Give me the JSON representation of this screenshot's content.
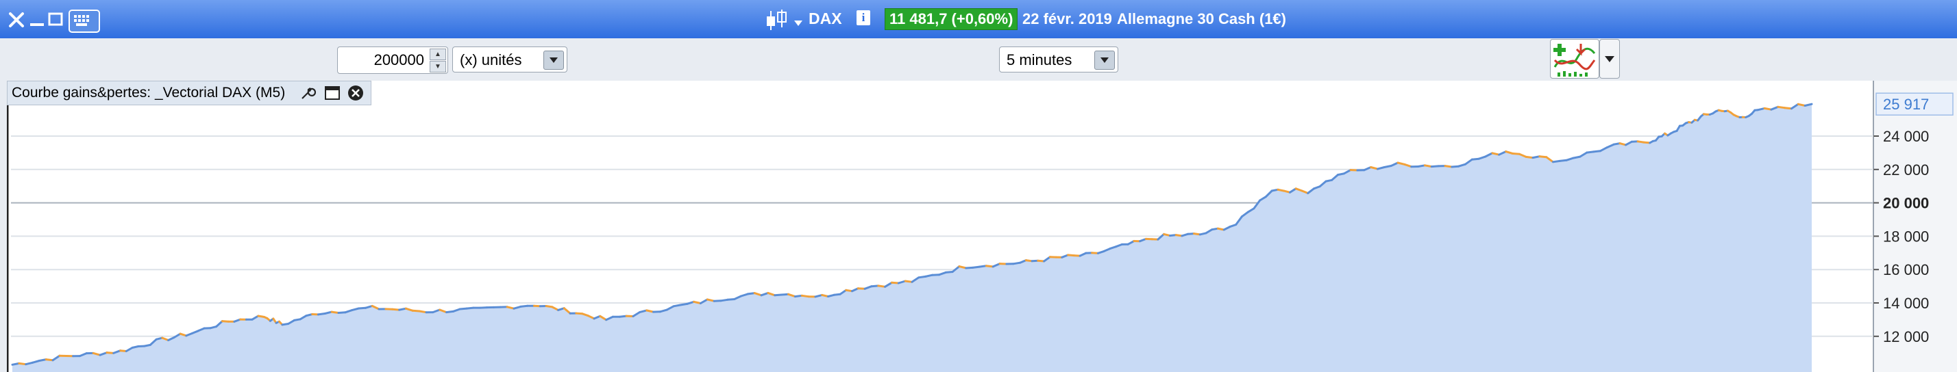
{
  "window": {
    "close_icon": "close-icon",
    "minimize_icon": "minimize-icon",
    "maximize_icon": "maximize-icon",
    "keyboard_icon": "keyboard-icon"
  },
  "header": {
    "symbol": "DAX",
    "price": "11 481,7 (+0,60%)",
    "date": "22 févr. 2019",
    "instrument": "Allemagne 30 Cash (1€)",
    "price_color": "#27a52a"
  },
  "toolbar": {
    "quantity": "200000",
    "unit_select": "(x) unités",
    "timeframe_select": "5 minutes"
  },
  "panel": {
    "title": "Courbe gains&pertes: _Vectorial DAX (M5)"
  },
  "chart_data": {
    "type": "area",
    "title": "Courbe gains&pertes: _Vectorial DAX (M5)",
    "ylim": [
      10000,
      26500
    ],
    "y_ticks": [
      "12 000",
      "14 000",
      "16 000",
      "18 000",
      "20 000",
      "22 000",
      "24 000"
    ],
    "last_value_label": "25 917",
    "last_value": 25917,
    "grid": true,
    "colors": {
      "line_up": "#5b8ed6",
      "line_down": "#f2a23a",
      "fill": "#c8daf5",
      "label": "#3d7bd0"
    },
    "x_index": [
      0,
      0.03,
      0.06,
      0.08,
      0.1,
      0.12,
      0.14,
      0.15,
      0.17,
      0.2,
      0.23,
      0.26,
      0.29,
      0.31,
      0.33,
      0.36,
      0.39,
      0.42,
      0.45,
      0.47,
      0.5,
      0.53,
      0.56,
      0.58,
      0.6,
      0.62,
      0.64,
      0.66,
      0.68,
      0.7,
      0.72,
      0.74,
      0.77,
      0.8,
      0.83,
      0.86,
      0.89,
      0.91,
      0.92,
      0.93,
      0.94,
      0.95,
      0.96,
      0.97,
      1.0
    ],
    "values": [
      10300,
      10800,
      11100,
      11700,
      12200,
      12900,
      13200,
      12700,
      13400,
      13700,
      13500,
      13600,
      13900,
      13500,
      13000,
      13600,
      14200,
      14600,
      14400,
      14900,
      15300,
      16200,
      16400,
      16700,
      16900,
      17500,
      18000,
      18100,
      18700,
      20800,
      20700,
      21800,
      22300,
      22200,
      23100,
      22500,
      23400,
      23700,
      24100,
      24700,
      25200,
      25600,
      25100,
      25500,
      25917
    ]
  }
}
